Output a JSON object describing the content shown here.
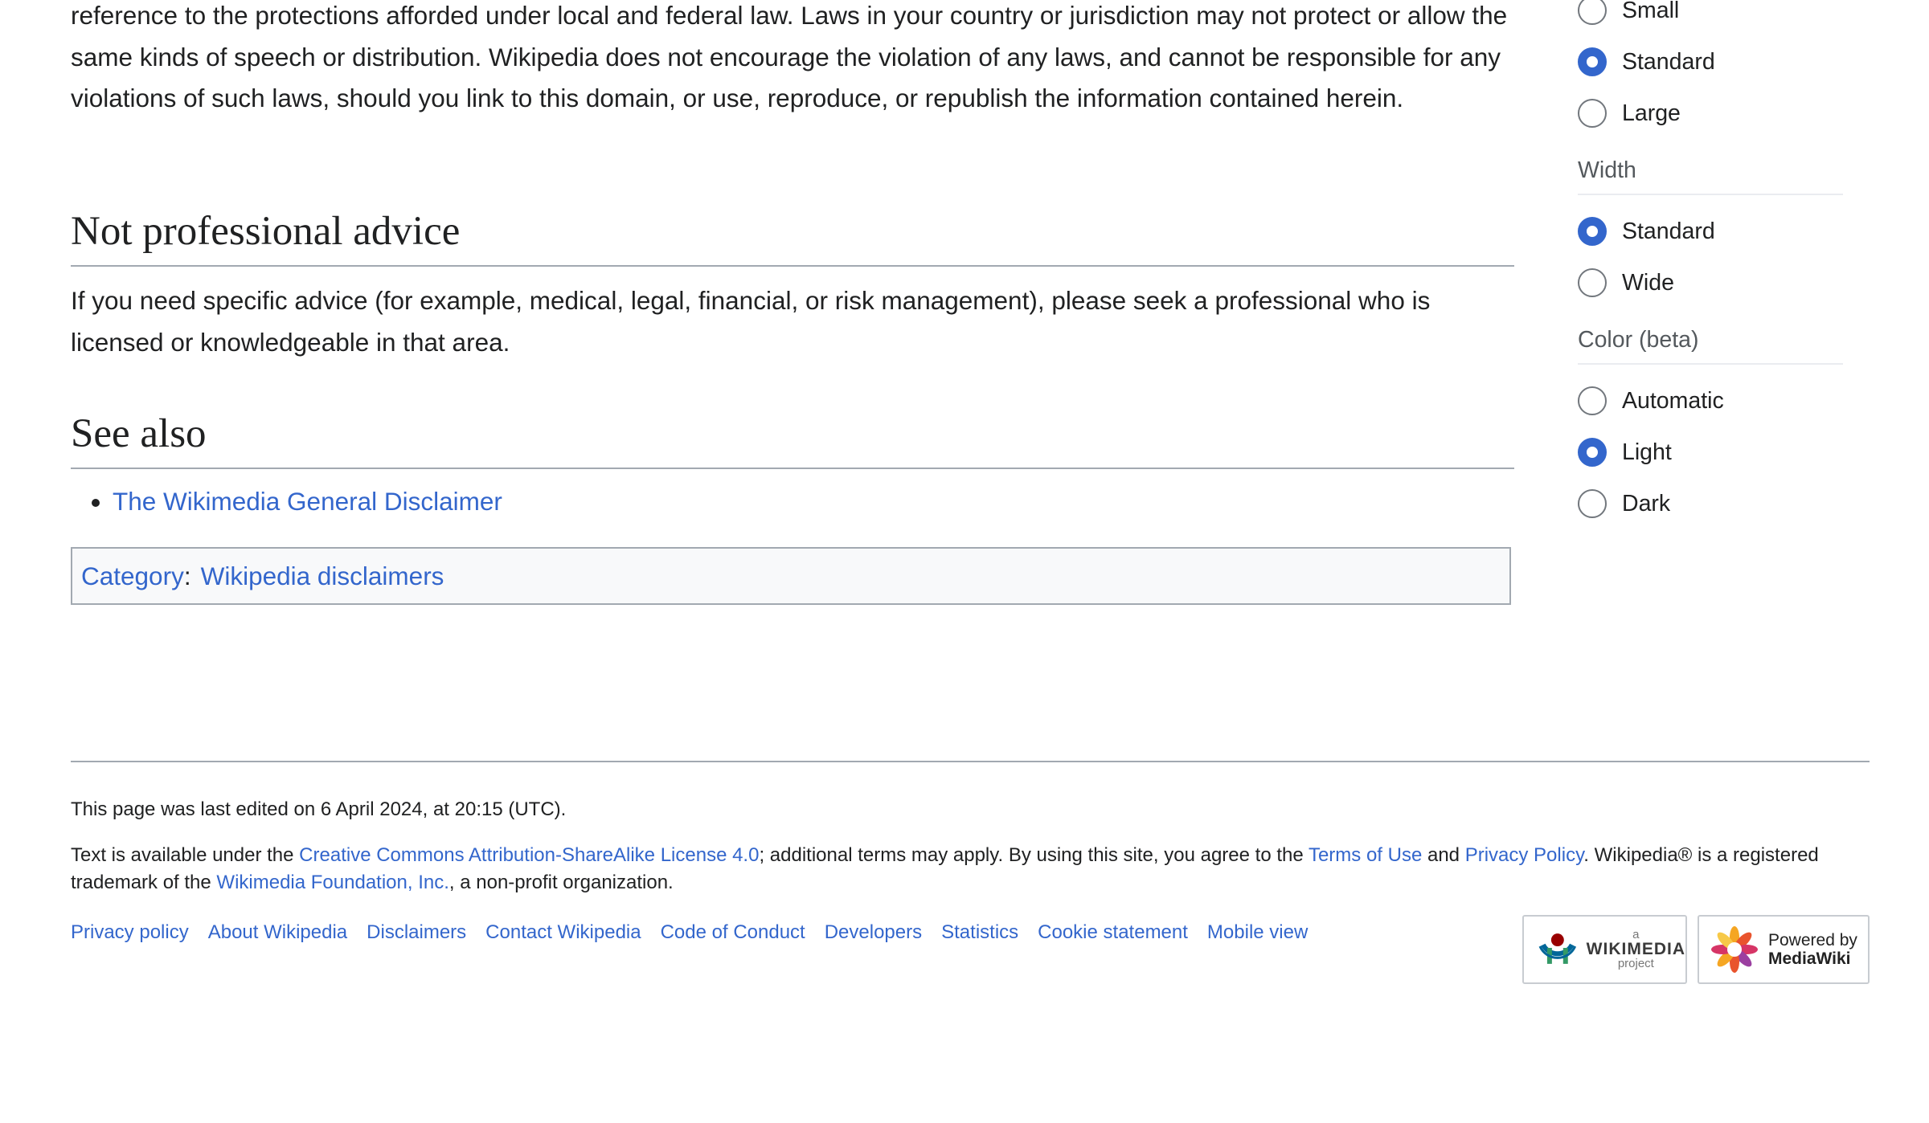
{
  "content": {
    "intro_paragraph": "reference to the protections afforded under local and federal law. Laws in your country or jurisdiction may not protect or allow the same kinds of speech or distribution. Wikipedia does not encourage the violation of any laws, and cannot be responsible for any violations of such laws, should you link to this domain, or use, reproduce, or republish the information contained herein.",
    "section1_heading": "Not professional advice",
    "section1_text": "If you need specific advice (for example, medical, legal, financial, or risk management), please seek a professional who is licensed or knowledgeable in that area.",
    "section2_heading": "See also",
    "see_also_link": "The Wikimedia General Disclaimer",
    "category_label": "Category",
    "category_colon": ":",
    "category_link": "Wikipedia disclaimers"
  },
  "appearance": {
    "text_options": [
      {
        "label": "Small",
        "selected": false
      },
      {
        "label": "Standard",
        "selected": true
      },
      {
        "label": "Large",
        "selected": false
      }
    ],
    "width_heading": "Width",
    "width_options": [
      {
        "label": "Standard",
        "selected": true
      },
      {
        "label": "Wide",
        "selected": false
      }
    ],
    "color_heading": "Color (beta)",
    "color_options": [
      {
        "label": "Automatic",
        "selected": false
      },
      {
        "label": "Light",
        "selected": true
      },
      {
        "label": "Dark",
        "selected": false
      }
    ]
  },
  "footer": {
    "last_modified": "This page was last edited on 6 April 2024, at 20:15 (UTC).",
    "license_pre": "Text is available under the ",
    "license_link": "Creative Commons Attribution-ShareAlike License 4.0",
    "license_mid": "; additional terms may apply. By using this site, you agree to the ",
    "terms_link": "Terms of Use",
    "and_text": " and ",
    "privacy_link": "Privacy Policy",
    "trademark_text": ". Wikipedia® is a registered trademark of the ",
    "foundation_link": "Wikimedia Foundation, Inc.",
    "nonprofit_text": ", a non-profit organization.",
    "links": [
      "Privacy policy",
      "About Wikipedia",
      "Disclaimers",
      "Contact Wikipedia",
      "Code of Conduct",
      "Developers",
      "Statistics",
      "Cookie statement",
      "Mobile view"
    ],
    "wikimedia_badge": {
      "line1": "a",
      "line2": "WIKIMEDIA",
      "line3": "project"
    },
    "mediawiki_badge": {
      "line1": "Powered by",
      "line2": "MediaWiki"
    }
  }
}
